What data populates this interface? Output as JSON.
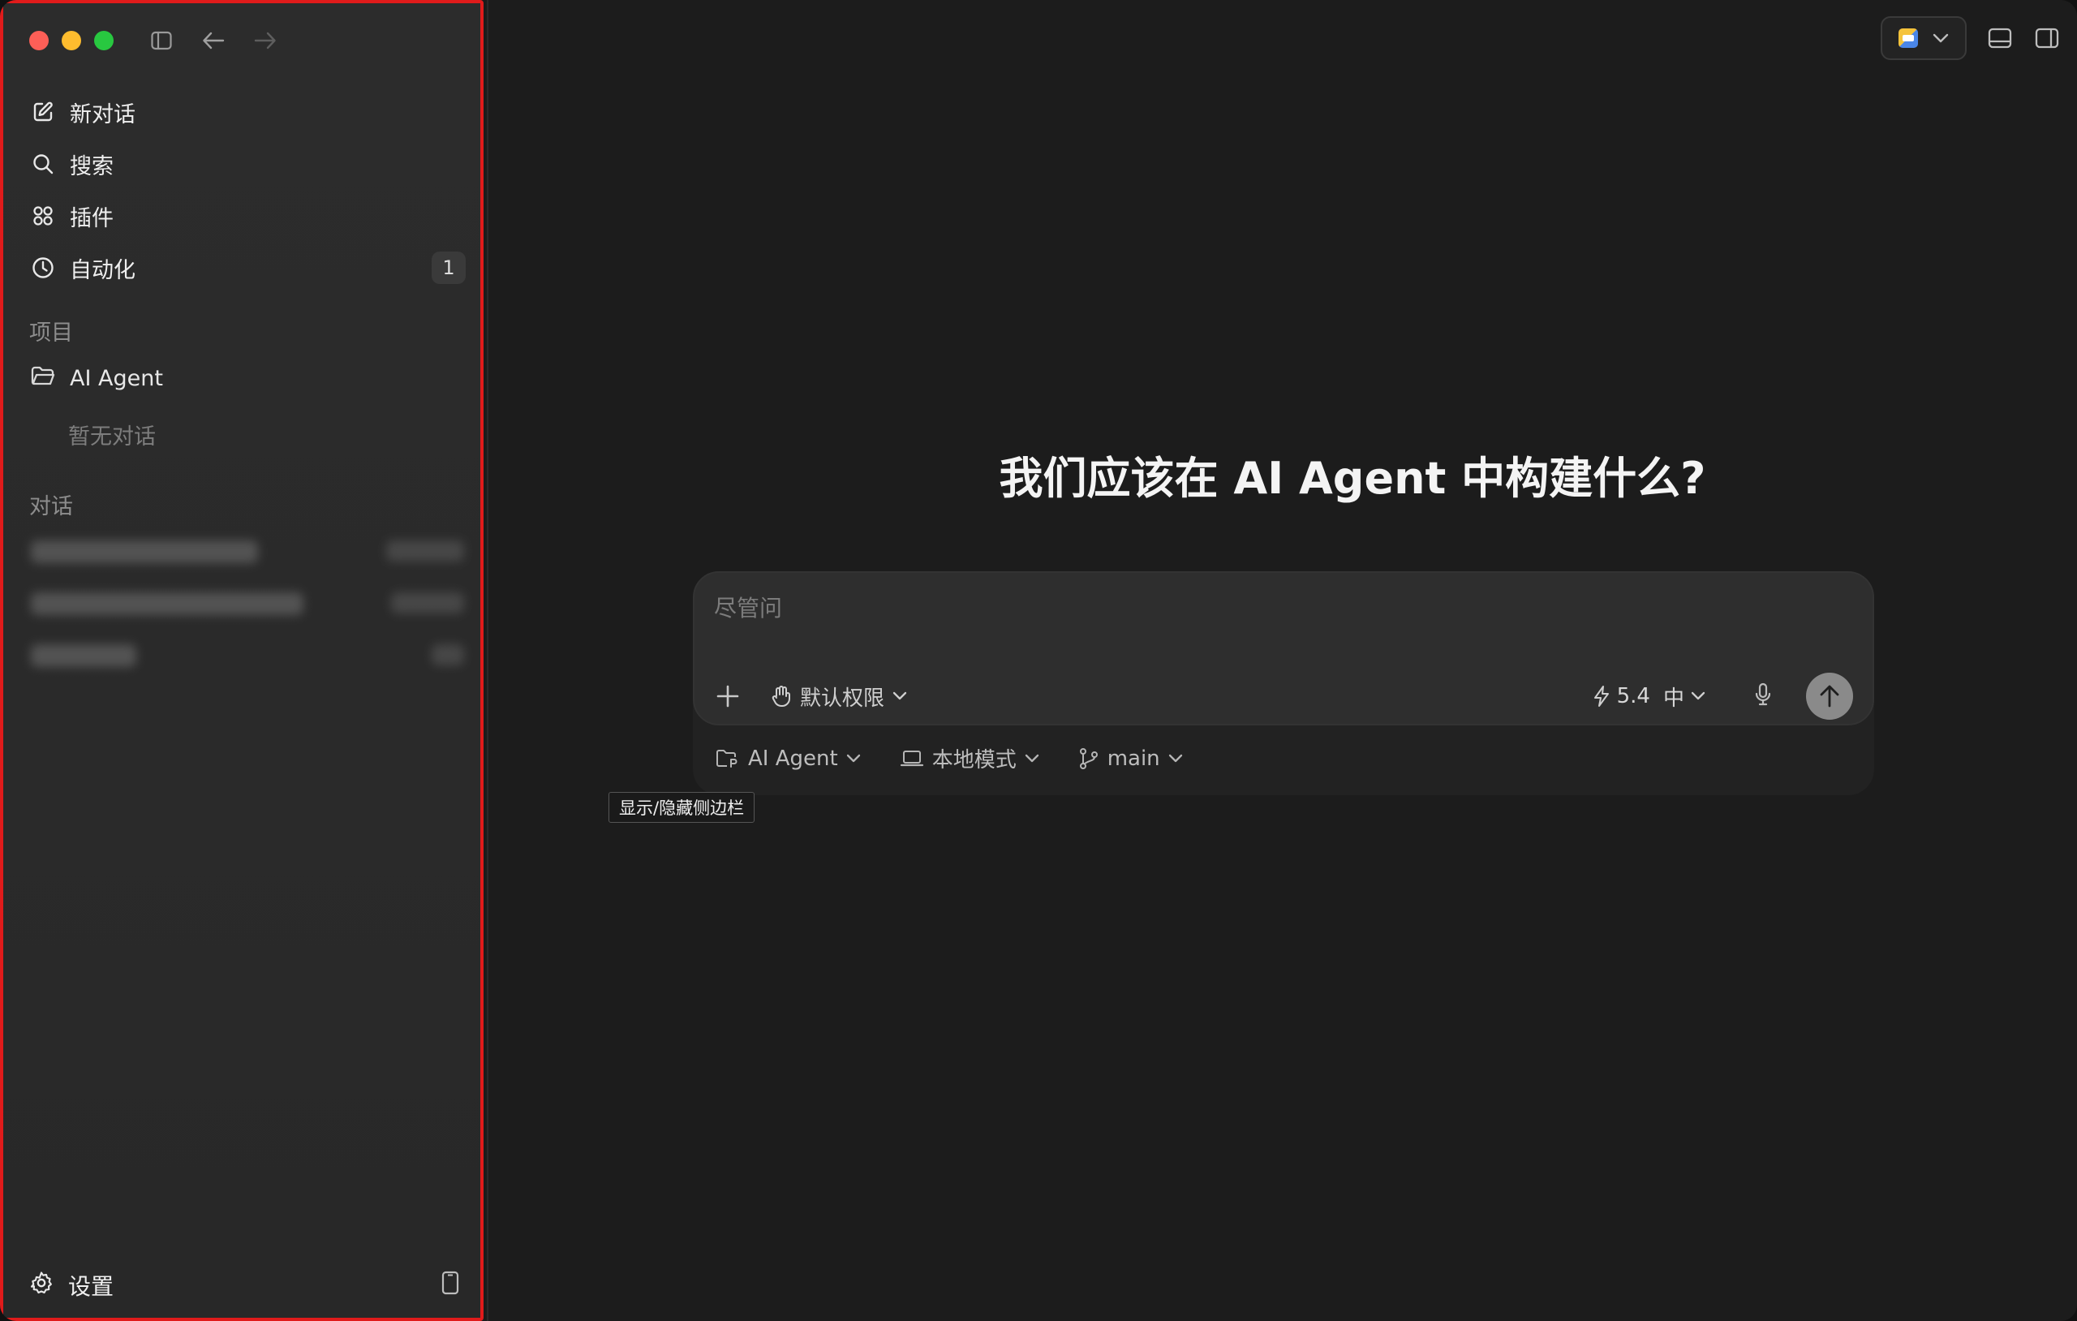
{
  "sidebar": {
    "nav": [
      {
        "label": "新对话",
        "icon": "compose-icon"
      },
      {
        "label": "搜索",
        "icon": "search-icon"
      },
      {
        "label": "插件",
        "icon": "plugins-icon"
      },
      {
        "label": "自动化",
        "icon": "clock-icon",
        "badge": "1"
      }
    ],
    "projects_label": "项目",
    "project": {
      "name": "AI Agent",
      "icon": "folder-icon"
    },
    "project_empty": "暂无对话",
    "chats_label": "对话",
    "settings_label": "设置"
  },
  "main": {
    "heading": "我们应该在 AI Agent 中构建什么?",
    "composer": {
      "placeholder": "尽管问",
      "permission": "默认权限",
      "model_version": "5.4",
      "model_effort": "中"
    },
    "footer": {
      "project": "AI Agent",
      "mode": "本地模式",
      "branch": "main"
    },
    "tooltip": "显示/隐藏侧边栏"
  },
  "colors": {
    "highlight_border": "#e01b1b",
    "traffic_red": "#fe5f57",
    "traffic_yellow": "#febc2e",
    "traffic_green": "#28c840"
  }
}
